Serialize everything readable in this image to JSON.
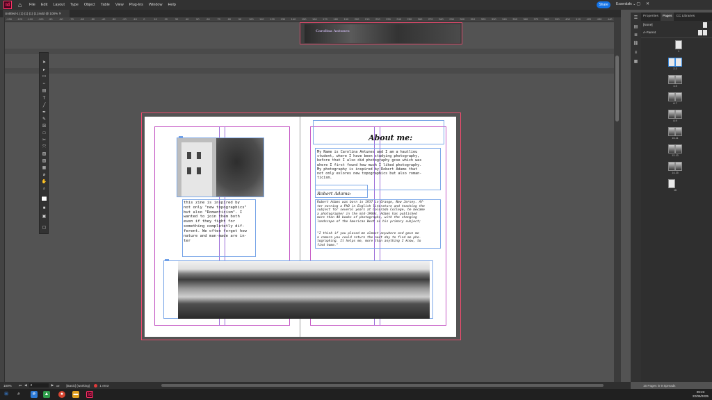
{
  "app": {
    "logo": "Id",
    "menus": [
      "File",
      "Edit",
      "Layout",
      "Type",
      "Object",
      "Table",
      "View",
      "Plug-Ins",
      "Window",
      "Help"
    ],
    "share_label": "Share",
    "workspace_label": "Essentials",
    "document_tab": "Untitled-1 (1) (1) (1) (1).indd @ 100%",
    "accent": "#ff3366",
    "share_color": "#1473e6"
  },
  "ruler": {
    "marks": [
      "-130",
      "-120",
      "-110",
      "-100",
      "-90",
      "-80",
      "-70",
      "-60",
      "-50",
      "-40",
      "-30",
      "-20",
      "-10",
      "0",
      "10",
      "20",
      "30",
      "40",
      "50",
      "60",
      "70",
      "80",
      "90",
      "100",
      "110",
      "120",
      "130",
      "140",
      "150",
      "160",
      "170",
      "180",
      "190",
      "200",
      "210",
      "220",
      "230",
      "240",
      "250",
      "260",
      "270",
      "280",
      "290",
      "300",
      "310",
      "320",
      "330",
      "340",
      "350",
      "360",
      "370",
      "380",
      "390",
      "400",
      "410",
      "420",
      "430",
      "440"
    ]
  },
  "previous_spread": {
    "title": "Carolina Antunes"
  },
  "left_page": {
    "intro_text": "this zine is inspired by\nnot only \"new topographics\"\nbut also \"Romanticism\". I\nwanted to join them both\neven if they fight for\nsomething completetly dif-\nferent. We often forget how\nnature and man-made are in-\nter"
  },
  "right_page": {
    "heading": "About me:",
    "about_text": "My Name is Carolina Antunes and I am a hautlieu\nstudent, where I have been studying photography,\nbefore that I also did photography gcse which was\nwhere I first found how much I liked photography.\nMy photography is inspired by Robert Adams that\nnot only exlores new topographics but also roman-\nticism.",
    "subheading": "Robert Adams:",
    "bio_text": "Robert Adams was born in 1937 in Orange, New Jersey. Af-\nter earning a PhD in English literature and teaching the\nsubject for several years at Colorado College, he became\na photographer in the mid-1960s. Adams has published\nmore than 40 books of photographs, with the changing\nlandscape of the American West as his primary subject;",
    "quote_text": "\"I think if you placed me almost anywhere and gave me\na camera you could return the next day to find me pho-\ntographing. It helps me, more than anything I know, to\nfind home.\""
  },
  "panel": {
    "tabs": [
      "Properties",
      "Pages",
      "CC Libraries"
    ],
    "active_tab": "Pages",
    "master_none": "[None]",
    "master_a": "A-Parent",
    "page_labels": [
      "1",
      "2-3",
      "4-5",
      "6-7",
      "8-9",
      "10-11",
      "12-13",
      "14-15",
      "16"
    ],
    "status": "16 Pages in 9 Spreads"
  },
  "statusbar": {
    "zoom": "100%",
    "page": "2",
    "style": "[Basic] (working)",
    "errors": "1 error"
  },
  "taskbar": {
    "time": "09:23",
    "date": "22/05/2025"
  }
}
